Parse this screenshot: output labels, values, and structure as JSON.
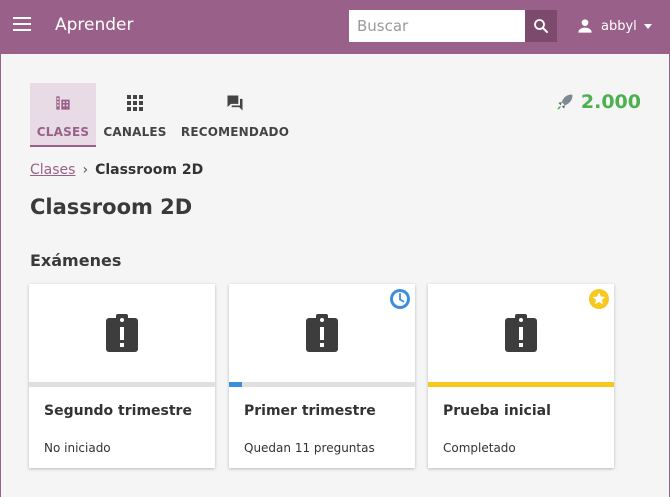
{
  "appbar": {
    "title": "Aprender",
    "search_placeholder": "Buscar",
    "username": "abbyl",
    "icons": {
      "menu": "hamburger-icon",
      "search": "search-icon",
      "user": "person-icon",
      "dropdown": "caret-down-icon"
    }
  },
  "tabs": [
    {
      "label": "CLASES",
      "icon": "classroom-icon",
      "active": true
    },
    {
      "label": "CANALES",
      "icon": "apps-grid-icon",
      "active": false
    },
    {
      "label": "RECOMENDADO",
      "icon": "forum-icon",
      "active": false
    }
  ],
  "points": {
    "value": "2.000",
    "icon": "rocket-icon",
    "color": "#4caf50"
  },
  "breadcrumb": {
    "parent": "Clases",
    "current": "Classroom 2D"
  },
  "page_title": "Classroom 2D",
  "section_title": "Exámenes",
  "colors": {
    "brand": "#996189",
    "progress_blue": "#3b8ddd",
    "progress_gold": "#f8c81e"
  },
  "exams": [
    {
      "title": "Segundo trimestre",
      "status": "No iniciado",
      "progress": 0,
      "badge": ""
    },
    {
      "title": "Primer trimestre",
      "status": "Quedan 11 preguntas",
      "progress": 0.07,
      "badge": "clock-icon"
    },
    {
      "title": "Prueba inicial",
      "status": "Completado",
      "progress": 1.0,
      "badge": "star-icon"
    }
  ]
}
